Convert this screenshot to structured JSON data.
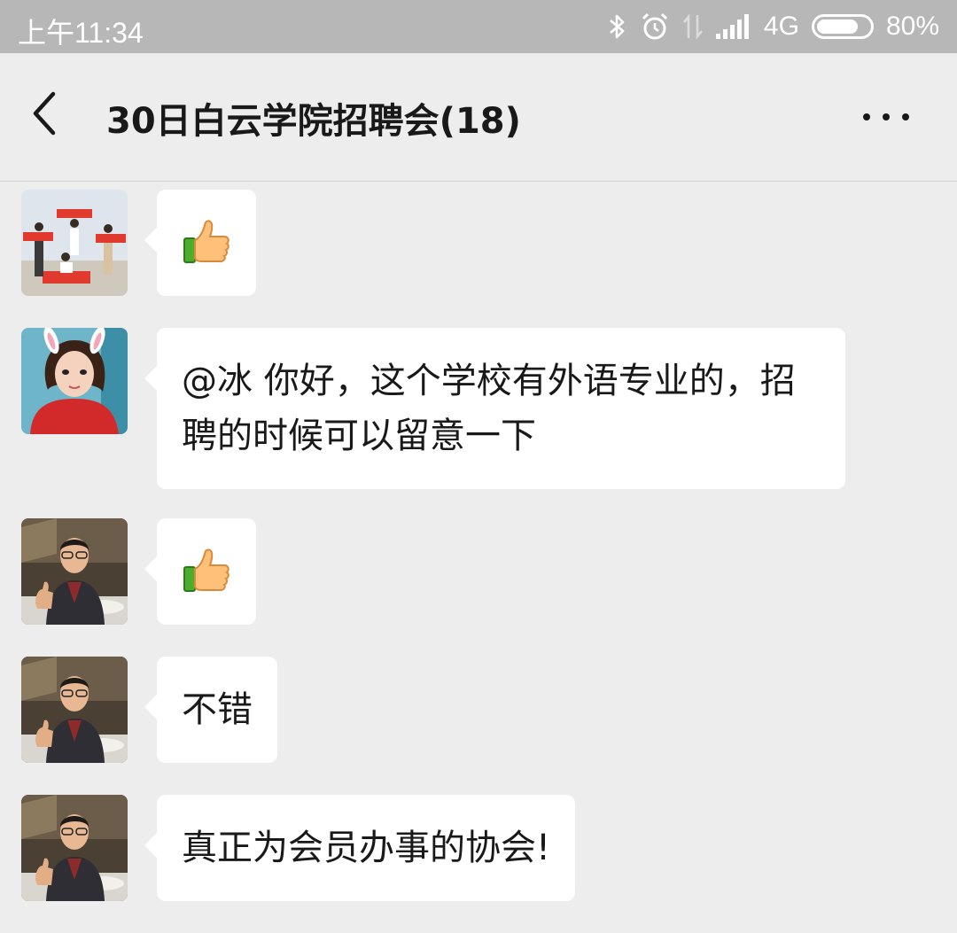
{
  "status_bar": {
    "time": "上午11:34",
    "network": "4G",
    "battery_percent": "80%",
    "battery_level": 0.8
  },
  "header": {
    "title": "30日白云学院招聘会(18)"
  },
  "messages": [
    {
      "type": "emoji",
      "emoji": "thumbs-up"
    },
    {
      "type": "text",
      "text_line1": "@冰 你好，这个学校有外语专业的，招",
      "text_line2": "聘的时候可以留意一下"
    },
    {
      "type": "emoji",
      "emoji": "thumbs-up"
    },
    {
      "type": "text",
      "text": "不错"
    },
    {
      "type": "text",
      "text": "真正为会员办事的协会!"
    }
  ],
  "colors": {
    "background": "#ededed",
    "bubble": "#ffffff",
    "status_bar": "#b7b7b7",
    "text": "#191919"
  }
}
